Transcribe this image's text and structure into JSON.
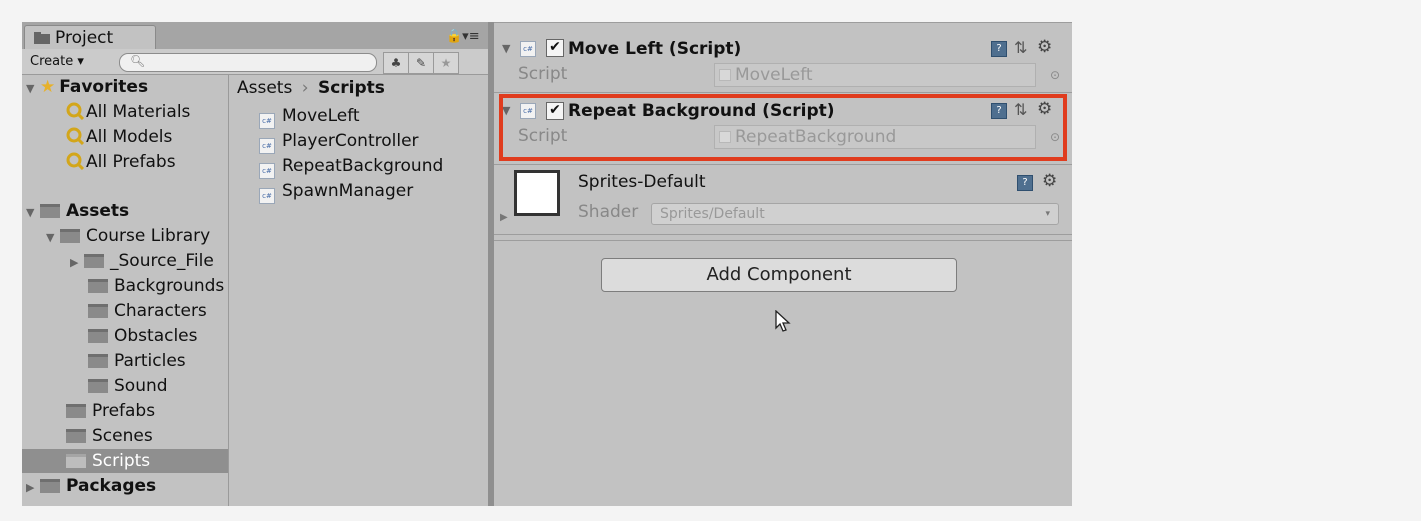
{
  "project_panel": {
    "tab_label": "Project",
    "create_label": "Create",
    "search_placeholder": "",
    "tree": {
      "favorites": {
        "label": "Favorites",
        "items": [
          "All Materials",
          "All Models",
          "All Prefabs"
        ]
      },
      "assets": {
        "label": "Assets",
        "course_library": "Course Library",
        "course_children": [
          "_Source_File",
          "Backgrounds",
          "Characters",
          "Obstacles",
          "Particles",
          "Sound"
        ],
        "other": [
          "Prefabs",
          "Scenes",
          "Scripts"
        ],
        "selected": "Scripts"
      },
      "packages": "Packages"
    },
    "breadcrumb": {
      "root": "Assets",
      "separator": "›",
      "current": "Scripts"
    },
    "files": [
      "MoveLeft",
      "PlayerController",
      "RepeatBackground",
      "SpawnManager"
    ]
  },
  "inspector": {
    "components": [
      {
        "title": "Move Left (Script)",
        "enabled": true,
        "prop_label": "Script",
        "prop_value": "MoveLeft"
      },
      {
        "title": "Repeat Background (Script)",
        "enabled": true,
        "prop_label": "Script",
        "prop_value": "RepeatBackground",
        "highlighted": true
      }
    ],
    "material": {
      "name": "Sprites-Default",
      "shader_label": "Shader",
      "shader_value": "Sprites/Default"
    },
    "add_component_label": "Add Component"
  },
  "colors": {
    "highlight": "#e03c1e",
    "panel_bg": "#c2c2c2",
    "selection": "#8f8f8f"
  },
  "icons": [
    "folder-icon",
    "star-icon",
    "search-icon",
    "lock-icon",
    "cs-script-icon",
    "help-icon",
    "preset-icon",
    "gear-icon",
    "cursor-icon"
  ]
}
